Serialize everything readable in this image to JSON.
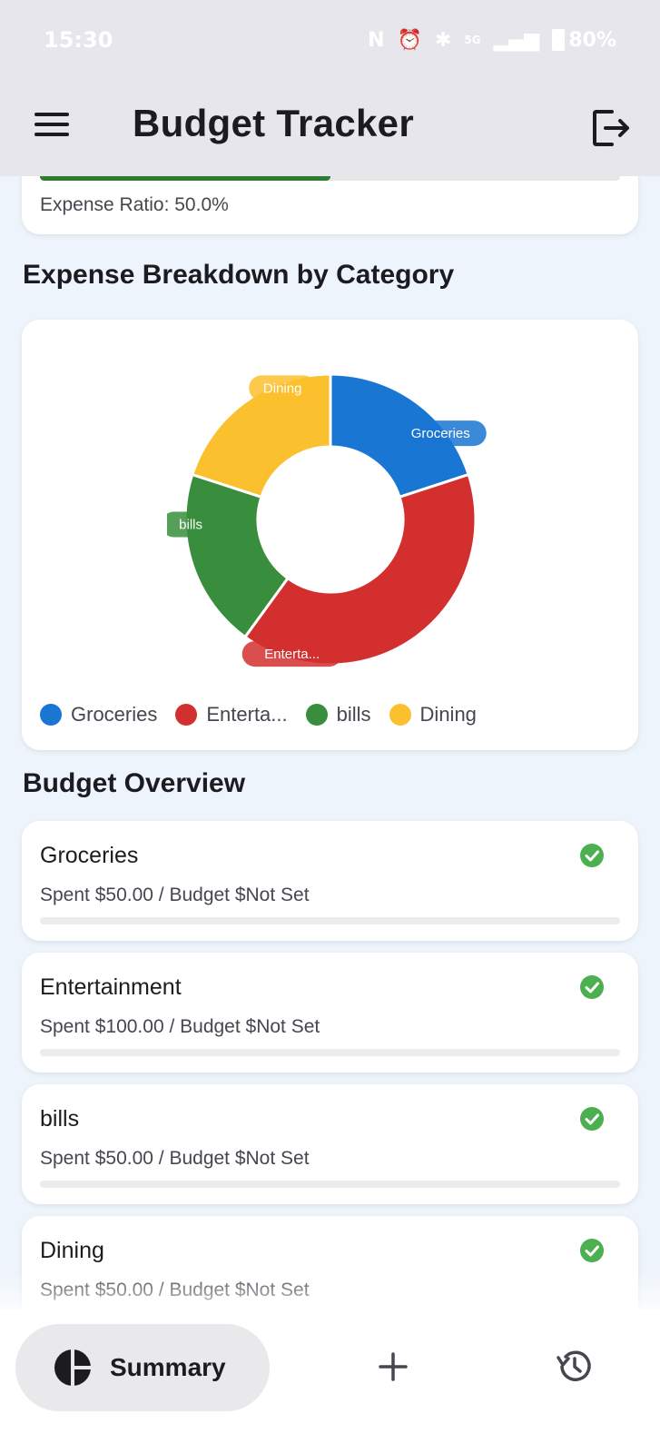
{
  "status_bar": {
    "time": "15:30",
    "battery": "80%",
    "network": "5G"
  },
  "app_bar": {
    "title": "Budget Tracker",
    "menu_icon": "hamburger-menu-icon",
    "logout_icon": "logout-icon"
  },
  "expense_ratio": {
    "label": "Expense Ratio: 50.0%",
    "progress": 0.5,
    "color": "#2e7d32"
  },
  "breakdown": {
    "title": "Expense Breakdown by Category"
  },
  "chart_data": {
    "type": "pie",
    "categories": [
      "Groceries",
      "Enterta...",
      "bills",
      "Dining"
    ],
    "values": [
      50,
      100,
      50,
      50
    ],
    "colors": [
      "#1976d2",
      "#d32f2f",
      "#388e3c",
      "#fbc02d"
    ],
    "slice_labels": [
      "Groceries",
      "Enterta...",
      "bills",
      "Dining"
    ],
    "legend": [
      "Groceries",
      "Enterta...",
      "bills",
      "Dining"
    ],
    "legend_placement": "bottom",
    "donut": true
  },
  "overview": {
    "title": "Budget Overview",
    "items": [
      {
        "name": "Groceries",
        "detail": "Spent $50.00 / Budget $Not Set",
        "status_icon": "check-circle-icon",
        "progress": 0
      },
      {
        "name": "Entertainment",
        "detail": "Spent $100.00 / Budget $Not Set",
        "status_icon": "check-circle-icon",
        "progress": 0
      },
      {
        "name": "bills",
        "detail": "Spent $50.00 / Budget $Not Set",
        "status_icon": "check-circle-icon",
        "progress": 0
      },
      {
        "name": "Dining",
        "detail": "Spent $50.00 / Budget $Not Set",
        "status_icon": "check-circle-icon",
        "progress": 0
      }
    ],
    "status_color": "#4caf50"
  },
  "bottom_nav": {
    "summary_label": "Summary",
    "summary_icon": "pie-chart-icon",
    "add_icon": "add-icon",
    "history_icon": "history-icon"
  }
}
